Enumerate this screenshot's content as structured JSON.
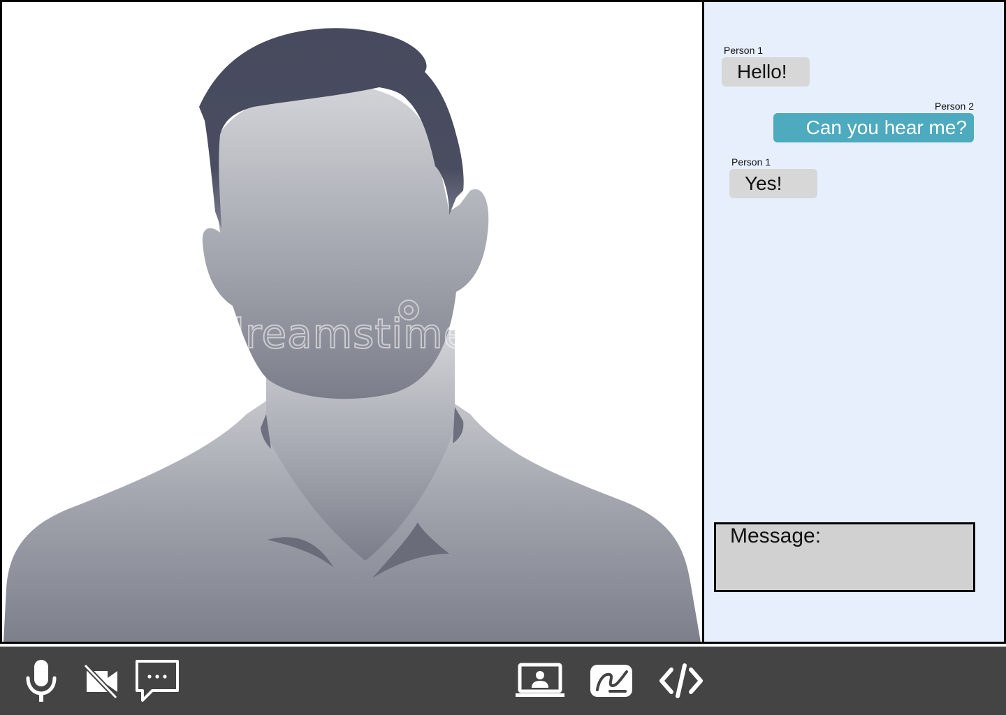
{
  "chat": {
    "messages": [
      {
        "sender": "Person 1",
        "text": "Hello!",
        "direction": "incoming"
      },
      {
        "sender": "Person 2",
        "text": "Can you hear me?",
        "direction": "outgoing"
      },
      {
        "sender": "Person 1",
        "text": "Yes!",
        "direction": "incoming"
      }
    ],
    "input_label": "Message:"
  },
  "video": {
    "watermark": "dreamstime"
  },
  "toolbar": {
    "left_tools": [
      "microphone-icon",
      "camera-off-icon",
      "chat-icon"
    ],
    "right_tools": [
      "screen-share-icon",
      "whiteboard-icon",
      "code-icon"
    ]
  },
  "colors": {
    "chat_background": "#e8effc",
    "incoming_bubble": "#d7d7d7",
    "outgoing_bubble": "#4daabf",
    "toolbar": "#444444",
    "message_box": "#d1d1d1"
  }
}
